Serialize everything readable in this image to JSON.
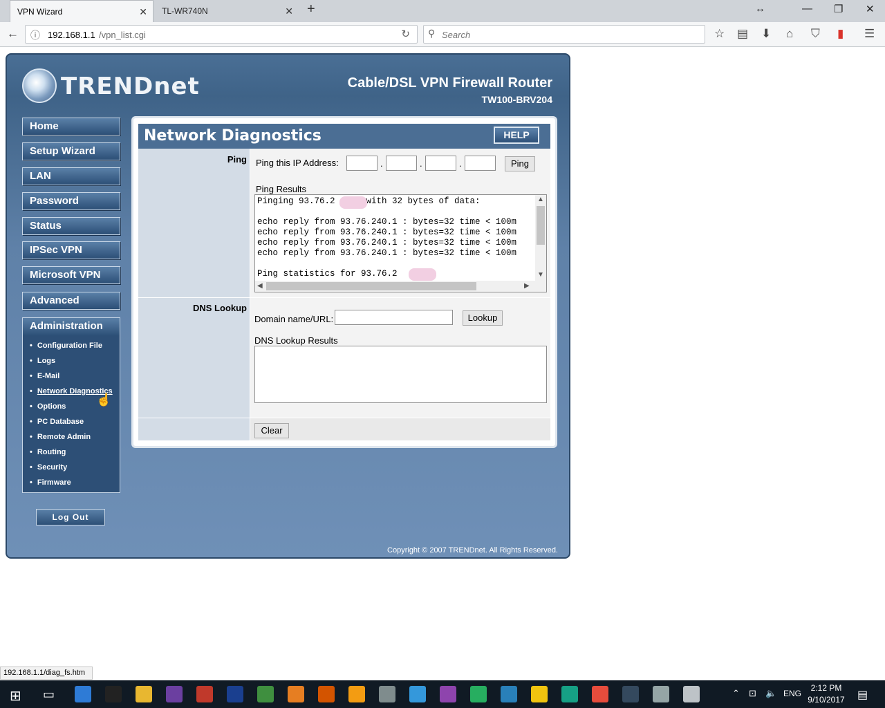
{
  "browser": {
    "tabs": [
      {
        "title": "VPN Wizard",
        "active": true
      },
      {
        "title": "TL-WR740N",
        "active": false
      }
    ],
    "url_host": "192.168.1.1",
    "url_path": "/vpn_list.cgi",
    "search_placeholder": "Search",
    "status_url": "192.168.1.1/diag_fs.htm"
  },
  "router": {
    "logo": "TRENDnet",
    "product": "Cable/DSL VPN Firewall Router",
    "model": "TW100-BRV204",
    "menu": [
      "Home",
      "Setup Wizard",
      "LAN",
      "Password",
      "Status",
      "IPSec VPN",
      "Microsoft VPN",
      "Advanced"
    ],
    "admin": {
      "label": "Administration",
      "items": [
        "Configuration File",
        "Logs",
        "E-Mail",
        "Network Diagnostics",
        "Options",
        "PC Database",
        "Remote Admin",
        "Routing",
        "Security",
        "Firmware"
      ],
      "current": "Network Diagnostics"
    },
    "logout": "Log Out",
    "copyright": "Copyright © 2007 TRENDnet. All Rights Reserved."
  },
  "diagnostics": {
    "title": "Network Diagnostics",
    "help": "HELP",
    "ping": {
      "section": "Ping",
      "ip_label": "Ping this IP Address:",
      "ip_octets": [
        "",
        "",
        "",
        ""
      ],
      "button": "Ping",
      "results_label": "Ping Results",
      "results": [
        "Pinging 93.76.2      with 32 bytes of data:",
        "",
        "echo reply from 93.76.240.1 : bytes=32 time < 100m",
        "echo reply from 93.76.240.1 : bytes=32 time < 100m",
        "echo reply from 93.76.240.1 : bytes=32 time < 100m",
        "echo reply from 93.76.240.1 : bytes=32 time < 100m",
        "",
        "Ping statistics for 93.76.2"
      ]
    },
    "dns": {
      "section": "DNS Lookup",
      "domain_label": "Domain name/URL:",
      "domain_value": "",
      "button": "Lookup",
      "results_label": "DNS Lookup Results",
      "results": ""
    },
    "clear": "Clear"
  },
  "taskbar": {
    "time": "2:12 PM",
    "date": "9/10/2017",
    "lang": "ENG",
    "app_colors": [
      "#2e7bd6",
      "#222222",
      "#e8b730",
      "#6b3fa0",
      "#c0392b",
      "#1a3f8f",
      "#3f8f3f",
      "#e67e22",
      "#d35400",
      "#f39c12",
      "#7f8c8d",
      "#3498db",
      "#8e44ad",
      "#27ae60",
      "#2980b9",
      "#f1c40f",
      "#16a085",
      "#e74c3c",
      "#34495e",
      "#95a5a6",
      "#bdc3c7"
    ]
  }
}
